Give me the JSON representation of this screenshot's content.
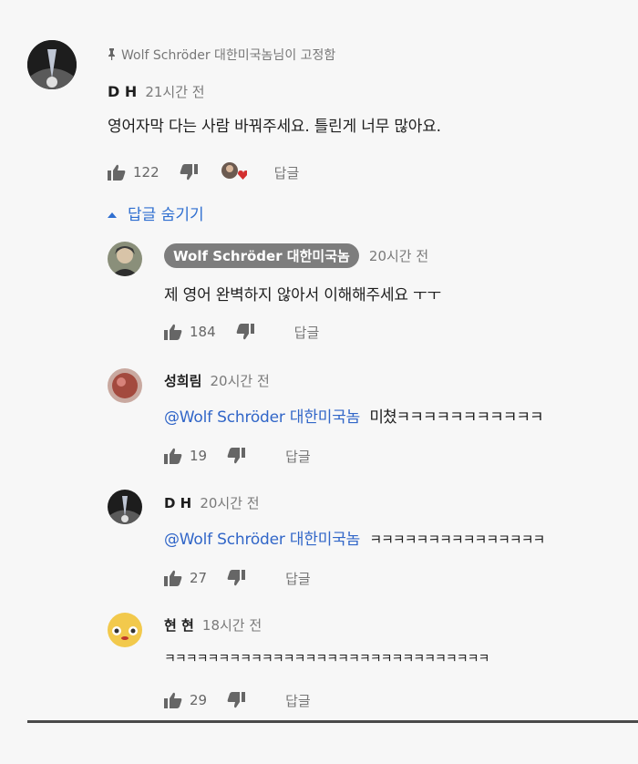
{
  "colors": {
    "background": "#f7f7f7",
    "link_blue": "#2f6fd0",
    "mention_blue": "#3166c8",
    "author_chip": "#7d7d7d",
    "heart_red": "#d32f2f"
  },
  "main_comment": {
    "pinned_label": "Wolf Schröder 대한미국놈님이 고정함",
    "author": "D H",
    "time": "21시간 전",
    "text": "영어자막 다는 사람 바꿔주세요. 틀린게 너무 많아요.",
    "likes": "122",
    "reply_label": "답글",
    "icons": {
      "pin": "pin-icon",
      "like": "thumbs-up-icon",
      "dislike": "thumbs-down-icon",
      "heart": "creator-heart-icon"
    }
  },
  "hide_replies_label": "답글 숨기기",
  "replies": [
    {
      "author": "Wolf Schröder 대한미국놈",
      "time": "20시간 전",
      "text": "제 영어 완벽하지 않아서 이해해주세요 ㅜㅜ",
      "likes": "184",
      "reply_label": "답글"
    },
    {
      "author": "성희림",
      "time": "20시간 전",
      "mention": "@Wolf Schröder 대한미국놈",
      "text": "미쳤ㅋㅋㅋㅋㅋㅋㅋㅋㅋㅋㅋ",
      "likes": "19",
      "reply_label": "답글"
    },
    {
      "author": "D H",
      "time": "20시간 전",
      "mention": "@Wolf Schröder 대한미국놈",
      "text": "ㅋㅋㅋㅋㅋㅋㅋㅋㅋㅋㅋㅋㅋㅋㅋ",
      "likes": "27",
      "reply_label": "답글"
    },
    {
      "author": "현 현",
      "time": "18시간 전",
      "text": "ㅋㅋㅋㅋㅋㅋㅋㅋㅋㅋㅋㅋㅋㅋㅋㅋㅋㅋㅋㅋㅋㅋㅋㅋㅋㅋㅋㅋㅋㅋ",
      "likes": "29",
      "reply_label": "답글"
    }
  ]
}
